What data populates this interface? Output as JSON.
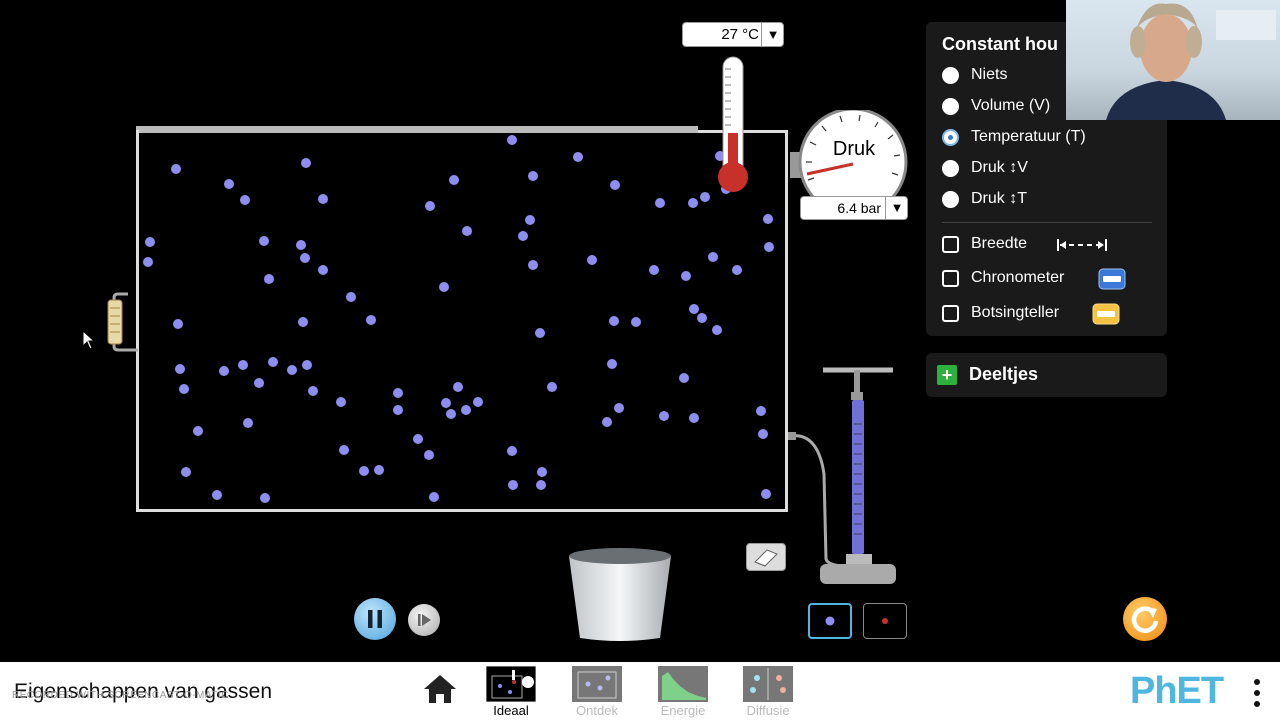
{
  "thermometer": {
    "value": "27 °C",
    "dropdown_arrow": "▼"
  },
  "pressure_gauge": {
    "label": "Druk",
    "value": "6.4 bar",
    "dropdown_arrow": "▼"
  },
  "control_panel": {
    "title": "Constant hou",
    "radio_options": [
      {
        "label": "Niets",
        "selected": false
      },
      {
        "label": "Volume (V)",
        "selected": false
      },
      {
        "label": "Temperatuur (T)",
        "selected": true
      },
      {
        "label": "Druk ↕V",
        "selected": false
      },
      {
        "label": "Druk ↕T",
        "selected": false
      }
    ],
    "checkbox_options": [
      {
        "label": "Breedte",
        "checked": false,
        "icon": "width-arrow-icon"
      },
      {
        "label": "Chronometer",
        "checked": false,
        "icon": "stopwatch-icon"
      },
      {
        "label": "Botsingteller",
        "checked": false,
        "icon": "collision-counter-icon"
      }
    ]
  },
  "particles_panel": {
    "label": "Deeltjes",
    "icon": "plus-icon"
  },
  "navbar": {
    "title": "Eigenschappen van gassen",
    "watermark": "RECORDED WITH SCREENCAST-O-MATIC",
    "tabs": [
      {
        "label": "Ideaal",
        "active": true
      },
      {
        "label": "Ontdek",
        "active": false
      },
      {
        "label": "Energie",
        "active": false
      },
      {
        "label": "Diffusie",
        "active": false
      }
    ],
    "logo": "PhET"
  },
  "colors": {
    "particle_heavy": "#8e8ef0",
    "selection_blue": "#4fb6e0",
    "reset_orange": "#f08a10",
    "thermometer_red": "#c8302a",
    "pump_purple": "#7070d8"
  }
}
